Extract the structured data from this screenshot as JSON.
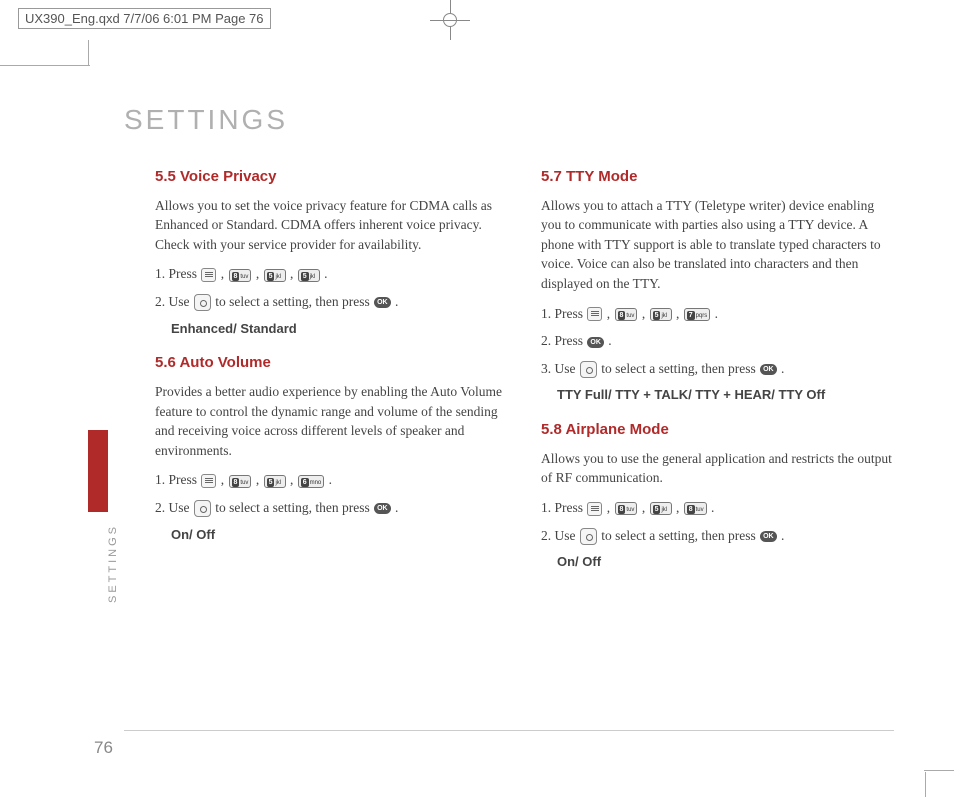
{
  "header": "UX390_Eng.qxd  7/7/06  6:01 PM  Page 76",
  "page_title": "SETTINGS",
  "side_label": "SETTINGS",
  "page_number": "76",
  "keys": {
    "k8": {
      "num": "8",
      "txt": "tuv"
    },
    "k5": {
      "num": "5",
      "txt": "jkl"
    },
    "k6": {
      "num": "6",
      "txt": "mno"
    },
    "k7": {
      "num": "7",
      "txt": "pqrs"
    },
    "ok": "OK"
  },
  "left": {
    "s55": {
      "title": "5.5 Voice Privacy",
      "desc": "Allows you to set the voice privacy feature for CDMA calls as Enhanced or Standard. CDMA offers inherent voice privacy. Check with your service provider for availability.",
      "step1a": "1. Press ",
      "step1b": " , ",
      "step1c": " , ",
      "step1d": " , ",
      "step1e": " .",
      "step2a": "2. Use ",
      "step2b": " to select a setting, then press ",
      "step2c": " .",
      "options": "Enhanced/ Standard"
    },
    "s56": {
      "title": "5.6 Auto Volume",
      "desc": "Provides a better audio experience by enabling the Auto Volume feature to control the dynamic range and volume of the sending and receiving voice across different levels of speaker and environments.",
      "step1a": "1. Press ",
      "step1e": " .",
      "step2a": "2. Use ",
      "step2b": " to select a setting, then press ",
      "step2c": " .",
      "options": "On/ Off"
    }
  },
  "right": {
    "s57": {
      "title": "5.7 TTY Mode",
      "desc": "Allows you to attach a TTY (Teletype writer) device enabling you to communicate with parties also using a TTY device. A phone with TTY support is able to translate typed characters to voice. Voice can also be translated into characters and then displayed on the TTY.",
      "step1a": "1. Press ",
      "step1e": " .",
      "step2a": "2. Press ",
      "step2b": " .",
      "step3a": "3. Use ",
      "step3b": " to select a setting, then press ",
      "step3c": " .",
      "options": "TTY Full/ TTY + TALK/ TTY + HEAR/ TTY Off"
    },
    "s58": {
      "title": "5.8 Airplane Mode",
      "desc": "Allows you to use the general application and restricts the output of RF communication.",
      "step1a": "1. Press ",
      "step1e": " .",
      "step2a": "2. Use ",
      "step2b": " to select a setting, then press ",
      "step2c": " .",
      "options": "On/ Off"
    }
  }
}
